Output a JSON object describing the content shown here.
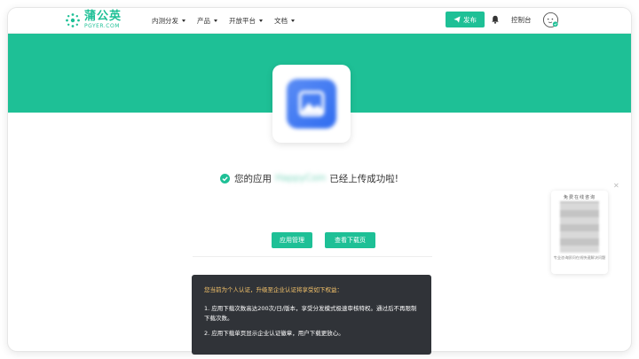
{
  "brand": {
    "name_cn": "蒲公英",
    "name_en": "PGYER.COM",
    "color": "#1ec096"
  },
  "nav": {
    "items": [
      {
        "label": "内测分发",
        "icon": "caret-down-icon"
      },
      {
        "label": "产品",
        "icon": "caret-down-icon"
      },
      {
        "label": "开放平台",
        "icon": "caret-down-icon"
      },
      {
        "label": "文档",
        "icon": "caret-down-icon"
      }
    ],
    "publish_label": "发布",
    "publish_icon": "paper-plane-icon",
    "bell_icon": "bell-icon",
    "console_label": "控制台",
    "avatar_icon": "avatar-icon"
  },
  "upload": {
    "success_prefix": "您的应用",
    "app_name": "HappyCoin",
    "success_suffix": "已经上传成功啦!",
    "check_icon": "check-circle-icon",
    "manage_button": "应用管理",
    "download_page_button": "查看下载页"
  },
  "notice": {
    "headline": "您当前为个人认证，升级至企业认证将享受如下权益：",
    "items": [
      "1. 应用下载次数高达200次/日/版本，享受分发模式极速审核特权。通过后不再限制下载次数。",
      "2. 应用下载单页显示企业认证徽章，用户下载更放心。"
    ]
  },
  "consult": {
    "title": "免费在线咨询",
    "desc": "专业咨询顾问在线快速解决问题",
    "close_icon": "close-icon"
  }
}
